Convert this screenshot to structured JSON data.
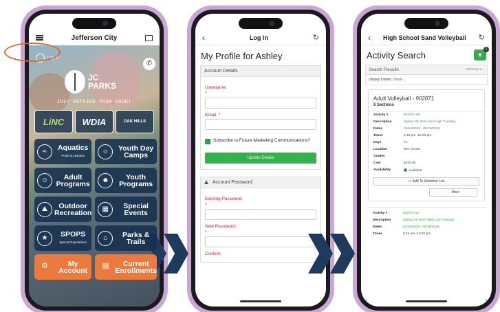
{
  "phone1": {
    "title": "Jefferson City",
    "login_label": "Log in",
    "brand_line1": "JC",
    "brand_line2": "PARKS",
    "tagline": "JUST OUTSIDE YOUR DOOR!",
    "partners": [
      "LiNC",
      "WDIA",
      "OAK HILLS"
    ],
    "tiles": [
      {
        "icon": "aquatics-icon",
        "glyph": "≈",
        "label": "Aquatics",
        "sub": "Pools & Lessons"
      },
      {
        "icon": "youth-day-camps-icon",
        "glyph": "☼",
        "label": "Youth Day Camps",
        "sub": ""
      },
      {
        "icon": "adult-programs-icon",
        "glyph": "☺",
        "label": "Adult Programs",
        "sub": ""
      },
      {
        "icon": "youth-programs-icon",
        "glyph": "☻",
        "label": "Youth Programs",
        "sub": ""
      },
      {
        "icon": "outdoor-recreation-icon",
        "glyph": "⛰",
        "label": "Outdoor Recreation",
        "sub": ""
      },
      {
        "icon": "special-events-icon",
        "glyph": "▦",
        "label": "Special Events",
        "sub": ""
      },
      {
        "icon": "spops-icon",
        "glyph": "★",
        "label": "SPOPS",
        "sub": "Special Populations"
      },
      {
        "icon": "parks-trails-icon",
        "glyph": "⌂",
        "label": "Parks & Trails",
        "sub": ""
      }
    ],
    "my_account": "My Account",
    "current_enrollments": "Current Enrollments"
  },
  "phone2": {
    "title": "Log In",
    "heading": "My Profile for Ashley",
    "account_details": "Account Details",
    "username_label": "Username:",
    "email_label": "Email:",
    "subscribe_label": "Subscribe to Future Marketing Communications?",
    "update_button": "Update Details",
    "account_password": "Account Password",
    "existing_password_label": "Existing Password:",
    "new_password_label": "New Password:",
    "confirm_label": "Confirm"
  },
  "phone3": {
    "title": "High School Sand Volleyball",
    "heading": "Activity Search",
    "filter_count": "1",
    "search_results": "Search Results",
    "showing": "Showing re...",
    "display_option_label": "Display Option:",
    "display_option_value": "Detail",
    "card_title": "Adult Volleyball - ",
    "card_code": "902071",
    "card_sections": "6 Sections",
    "rows": [
      {
        "k": "Activity #",
        "v": "902071-1B",
        "green": true
      },
      {
        "k": "Description",
        "v": "Spring VB Wom Med High Tuesday",
        "green": true
      },
      {
        "k": "Dates",
        "v": "03/10/2026 - 05/19/2026",
        "green": true
      },
      {
        "k": "Times",
        "v": "5:45 pm -10:00 pm",
        "green": false
      },
      {
        "k": "Days",
        "v": "Tu",
        "green": false
      },
      {
        "k": "Location",
        "v": "Rec Center",
        "green": false
      },
      {
        "k": "Grades",
        "v": "",
        "green": false
      },
      {
        "k": "Cost",
        "v": "$240.00",
        "green": false
      },
      {
        "k": "Availability",
        "v": "Available",
        "green": false
      }
    ],
    "add_button": "Add To Selection List",
    "more_button": "More",
    "rows2": [
      {
        "k": "Activity #",
        "v": "902071-1C",
        "green": true
      },
      {
        "k": "Description",
        "v": "Spring VB Wom Med Low Tuesday",
        "green": true
      },
      {
        "k": "Dates",
        "v": "03/10/2026 - 05/19/2026",
        "green": true
      },
      {
        "k": "Times",
        "v": "5:45 pm -10:00 pm",
        "green": false
      }
    ]
  }
}
